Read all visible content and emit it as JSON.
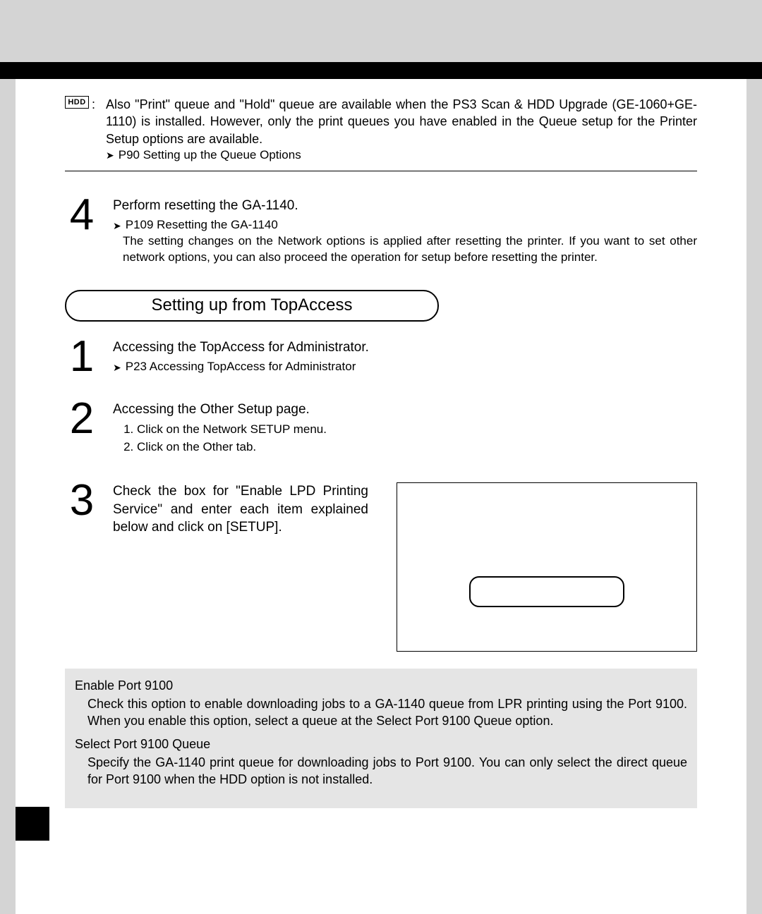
{
  "hdd": {
    "icon_label": "HDD",
    "text": "Also \"Print\" queue and \"Hold\" queue are available when the PS3 Scan & HDD Upgrade (GE-1060+GE-1110) is installed.  However, only the print queues you have enabled in the Queue setup for the Printer Setup options are available.",
    "ref": "P90  Setting up the Queue Options"
  },
  "step4": {
    "num": "4",
    "title": "Perform resetting the GA-1140.",
    "ref": "P109  Resetting the GA-1140",
    "note": "The setting changes on the Network options is applied after resetting the printer.  If you want to set other network options, you can also proceed the operation for setup before resetting the printer."
  },
  "section_title": "Setting up from TopAccess",
  "ta_step1": {
    "num": "1",
    "title": "Accessing the TopAccess for Administrator.",
    "ref": "P23  Accessing TopAccess for Administrator"
  },
  "ta_step2": {
    "num": "2",
    "title": "Accessing the Other Setup page.",
    "items": [
      "Click on the Network SETUP menu.",
      "Click on the Other tab."
    ]
  },
  "ta_step3": {
    "num": "3",
    "text": "Check the box for \"Enable LPD Printing Service\" and enter each item explained below and click on [SETUP]."
  },
  "desc": {
    "port9100_label": "Enable Port 9100",
    "port9100_text": "Check this option to enable downloading jobs to a GA-1140 queue from LPR printing using the Port 9100.  When you enable this option, select a queue at the Select Port 9100 Queue option.",
    "select_label": "Select Port 9100 Queue",
    "select_text": "Specify the GA-1140 print queue for downloading jobs to Port 9100.  You can only select the direct queue for Port 9100 when the HDD option is not installed."
  }
}
